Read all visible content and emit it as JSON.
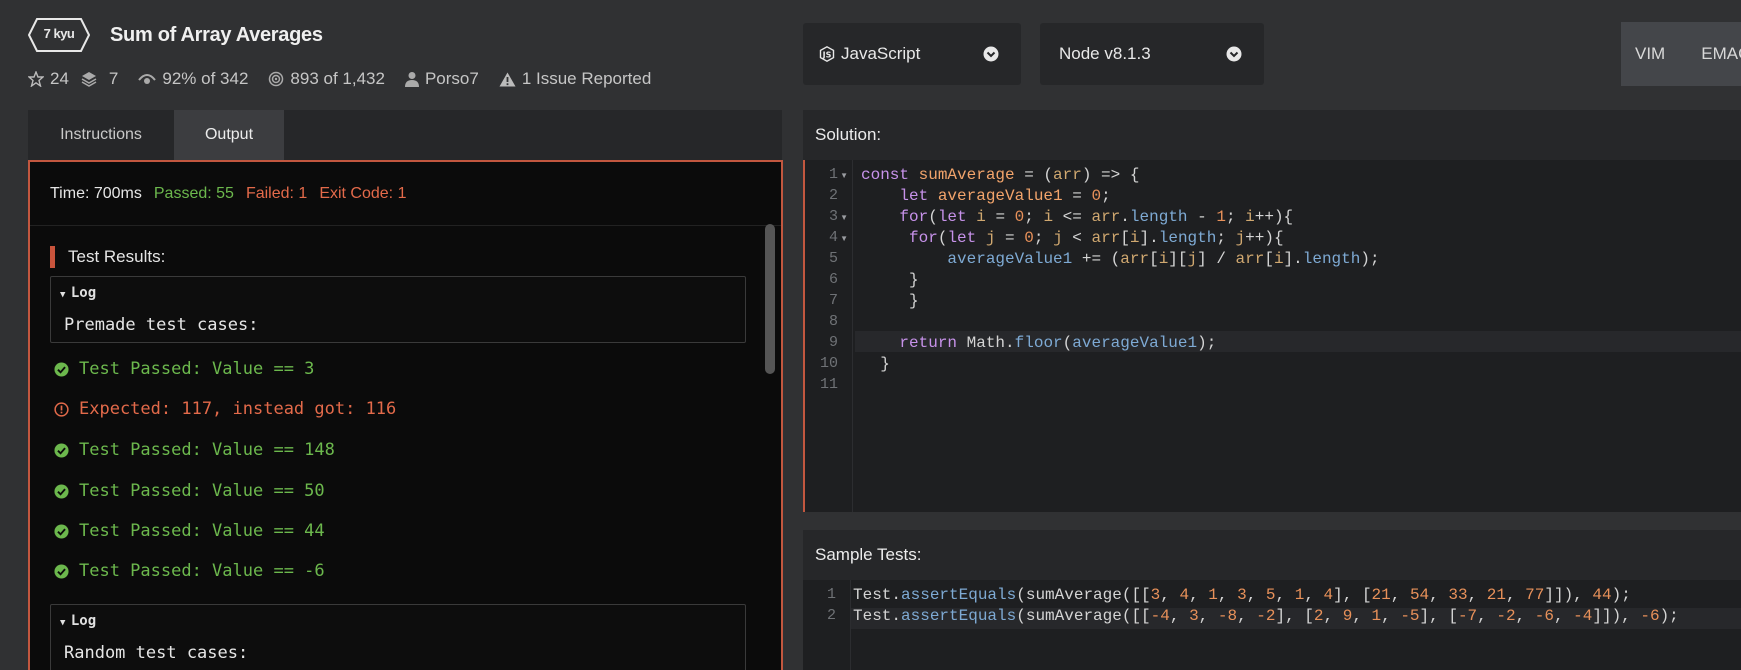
{
  "kata": {
    "rank": "7 kyu",
    "title": "Sum of Array Averages",
    "stats": {
      "stars": "24",
      "collections": "7",
      "satisfaction": "92% of 342",
      "completed": "893 of 1,432",
      "author": "Porso7",
      "issues": "1 Issue Reported"
    }
  },
  "selectors": {
    "language": "JavaScript",
    "runtime": "Node v8.1.3"
  },
  "keymap": [
    "VIM",
    "EMACS"
  ],
  "tabs": {
    "instructions": "Instructions",
    "output": "Output"
  },
  "output": {
    "time": "Time: 700ms",
    "passed": "Passed: 55",
    "failed": "Failed: 1",
    "exit_code": "Exit Code: 1",
    "results_title": "Test Results:",
    "log1": {
      "title": "Log",
      "body": "Premade test cases:"
    },
    "lines": [
      {
        "status": "pass",
        "text": "Test Passed: Value == 3"
      },
      {
        "status": "fail",
        "text": "Expected: 117, instead got: 116"
      },
      {
        "status": "pass",
        "text": "Test Passed: Value == 148"
      },
      {
        "status": "pass",
        "text": "Test Passed: Value == 50"
      },
      {
        "status": "pass",
        "text": "Test Passed: Value == 44"
      },
      {
        "status": "pass",
        "text": "Test Passed: Value == -6"
      }
    ],
    "log2": {
      "title": "Log",
      "body": "Random test cases:"
    }
  },
  "solution": {
    "title": "Solution:",
    "line_numbers": [
      "1",
      "2",
      "3",
      "4",
      "5",
      "6",
      "7",
      "8",
      "9",
      "10",
      "11"
    ]
  },
  "sample_tests": {
    "title": "Sample Tests:",
    "line_numbers": [
      "1",
      "2"
    ]
  },
  "colors": {
    "accent": "#c2573f",
    "pass": "#6cb84d",
    "fail": "#e36a4a",
    "background": "#303133",
    "panel": "#262729"
  },
  "icons": [
    "hexagon-badge-icon",
    "star-icon",
    "layers-icon",
    "eye-icon",
    "target-icon",
    "user-icon",
    "warning-icon",
    "javascript-icon",
    "chevron-down-icon",
    "check-circle-icon",
    "error-circle-icon",
    "caret-down-icon"
  ]
}
